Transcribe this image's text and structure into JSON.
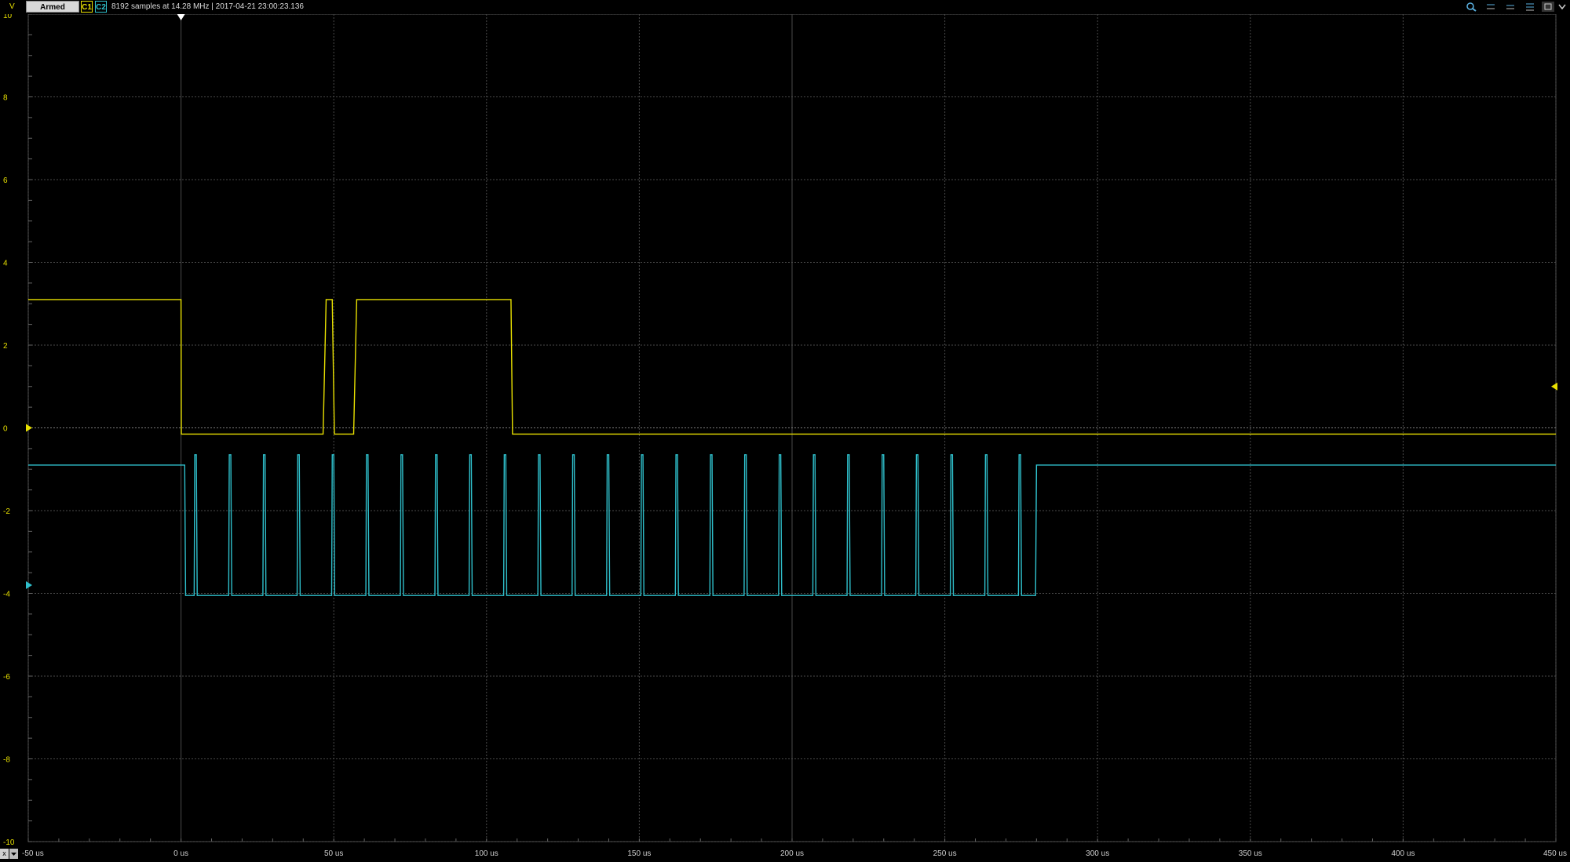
{
  "toolbar": {
    "unit": "V",
    "status": "Armed",
    "channel1": "C1",
    "channel2": "C2",
    "info": "8192 samples at 14.28 MHz | 2017-04-21 23:00:23.136",
    "icons": [
      "zoom-icon",
      "zoom-out-icon",
      "zoom-fit-icon",
      "zoom-reset-icon",
      "restore-window-icon",
      "menu-chevron-icon"
    ]
  },
  "colors": {
    "background": "#000000",
    "grid": "#4a4a4a",
    "channel1": "#e8e000",
    "channel2": "#2fc0cc",
    "axis_text": "#e8e000",
    "time_text": "#cfcfcf"
  },
  "bottom_controls": {
    "close": "x"
  },
  "chart_data": {
    "type": "line",
    "xlabel": "",
    "ylabel": "V",
    "xlim_us": [
      -50,
      450
    ],
    "ylim": [
      -10,
      10
    ],
    "x_ticks": [
      "-50 us",
      "0 us",
      "50 us",
      "100 us",
      "150 us",
      "200 us",
      "250 us",
      "300 us",
      "350 us",
      "400 us",
      "450 us"
    ],
    "y_ticks": [
      "10",
      "8",
      "6",
      "4",
      "2",
      "0",
      "-2",
      "-4",
      "-6",
      "-8",
      "-10"
    ],
    "grid": true,
    "trigger_time_us": 0,
    "channel_offsets": {
      "C1": 0,
      "C2": -3.8,
      "C1_trigger_level": 1.0
    },
    "series": [
      {
        "name": "C1",
        "points_us_v": [
          [
            -50,
            3.1
          ],
          [
            0,
            3.1
          ],
          [
            0.1,
            -0.15
          ],
          [
            46.5,
            -0.15
          ],
          [
            47.5,
            3.1
          ],
          [
            49.5,
            3.1
          ],
          [
            50.2,
            -0.15
          ],
          [
            56.5,
            -0.15
          ],
          [
            57.5,
            3.1
          ],
          [
            108,
            3.1
          ],
          [
            108.5,
            -0.15
          ],
          [
            450,
            -0.15
          ]
        ]
      },
      {
        "name": "C2",
        "high_v": -0.9,
        "low_v": -4.05,
        "start_low_us": 1.5,
        "pulse_high_times_us": [
          4.5,
          15.8,
          27,
          38.2,
          49.5,
          60.7,
          72,
          83.3,
          94.5,
          105.8,
          117,
          128.2,
          139.5,
          150.7,
          162,
          173.3,
          184.5,
          195.8,
          207,
          218.2,
          229.5,
          240.7,
          252,
          263.3,
          274.3
        ],
        "end_high_us": 280
      }
    ]
  }
}
